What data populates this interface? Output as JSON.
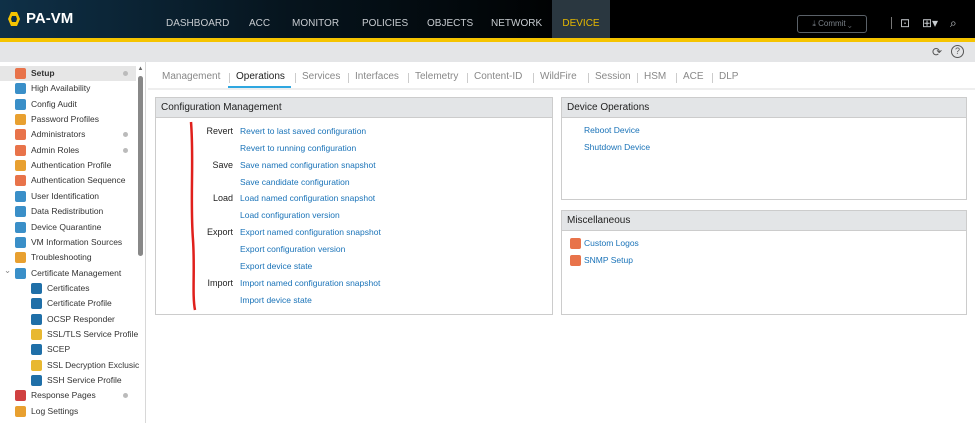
{
  "header": {
    "logo": "PA-VM",
    "nav": [
      "DASHBOARD",
      "ACC",
      "MONITOR",
      "POLICIES",
      "OBJECTS",
      "NETWORK",
      "DEVICE"
    ],
    "active_nav": "DEVICE",
    "commit_label": "Commit ⌄"
  },
  "sidebar": {
    "items": [
      {
        "label": "Setup",
        "color": "#e8734a",
        "selected": true,
        "dot": true
      },
      {
        "label": "High Availability",
        "color": "#3a8fc8"
      },
      {
        "label": "Config Audit",
        "color": "#3a8fc8"
      },
      {
        "label": "Password Profiles",
        "color": "#e8a030"
      },
      {
        "label": "Administrators",
        "color": "#e8734a",
        "dot": true
      },
      {
        "label": "Admin Roles",
        "color": "#e8734a",
        "dot": true
      },
      {
        "label": "Authentication Profile",
        "color": "#e8a030"
      },
      {
        "label": "Authentication Sequence",
        "color": "#e8734a"
      },
      {
        "label": "User Identification",
        "color": "#3a8fc8"
      },
      {
        "label": "Data Redistribution",
        "color": "#3a8fc8"
      },
      {
        "label": "Device Quarantine",
        "color": "#3a8fc8"
      },
      {
        "label": "VM Information Sources",
        "color": "#3a8fc8"
      },
      {
        "label": "Troubleshooting",
        "color": "#e8a030"
      },
      {
        "label": "Certificate Management",
        "color": "#3a8fc8",
        "expanded": true
      },
      {
        "label": "Certificates",
        "color": "#1f6fa8",
        "indent": true
      },
      {
        "label": "Certificate Profile",
        "color": "#1f6fa8",
        "indent": true
      },
      {
        "label": "OCSP Responder",
        "color": "#1f6fa8",
        "indent": true
      },
      {
        "label": "SSL/TLS Service Profile",
        "color": "#e8b830",
        "indent": true
      },
      {
        "label": "SCEP",
        "color": "#1f6fa8",
        "indent": true
      },
      {
        "label": "SSL Decryption Exclusic",
        "color": "#e8b830",
        "indent": true
      },
      {
        "label": "SSH Service Profile",
        "color": "#1f6fa8",
        "indent": true
      },
      {
        "label": "Response Pages",
        "color": "#d04040",
        "dot": true
      },
      {
        "label": "Log Settings",
        "color": "#e8a030"
      }
    ]
  },
  "tabs": [
    "Management",
    "Operations",
    "Services",
    "Interfaces",
    "Telemetry",
    "Content-ID",
    "WildFire",
    "Session",
    "HSM",
    "ACE",
    "DLP"
  ],
  "active_tab": "Operations",
  "config_mgmt": {
    "title": "Configuration Management",
    "rows": [
      {
        "label": "Revert",
        "link": "Revert to last saved configuration"
      },
      {
        "label": "",
        "link": "Revert to running configuration"
      },
      {
        "label": "Save",
        "link": "Save named configuration snapshot"
      },
      {
        "label": "",
        "link": "Save candidate configuration"
      },
      {
        "label": "Load",
        "link": "Load named configuration snapshot"
      },
      {
        "label": "",
        "link": "Load configuration version"
      },
      {
        "label": "Export",
        "link": "Export named configuration snapshot"
      },
      {
        "label": "",
        "link": "Export configuration version"
      },
      {
        "label": "",
        "link": "Export device state"
      },
      {
        "label": "Import",
        "link": "Import named configuration snapshot"
      },
      {
        "label": "",
        "link": "Import device state"
      }
    ]
  },
  "device_ops": {
    "title": "Device Operations",
    "links": [
      "Reboot Device",
      "Shutdown Device"
    ]
  },
  "misc": {
    "title": "Miscellaneous",
    "links": [
      "Custom Logos",
      "SNMP Setup"
    ]
  }
}
